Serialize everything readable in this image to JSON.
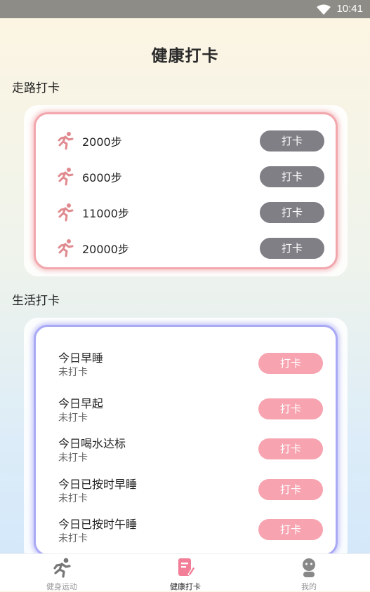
{
  "status_bar": {
    "time": "10:41"
  },
  "page": {
    "title": "健康打卡"
  },
  "walk": {
    "section_title": "走路打卡",
    "items": [
      {
        "steps": "2000步",
        "button": "打卡"
      },
      {
        "steps": "6000步",
        "button": "打卡"
      },
      {
        "steps": "11000步",
        "button": "打卡"
      },
      {
        "steps": "20000步",
        "button": "打卡"
      }
    ]
  },
  "life": {
    "section_title": "生活打卡",
    "items": [
      {
        "name": "今日早睡",
        "status": "未打卡",
        "button": "打卡"
      },
      {
        "name": "今日早起",
        "status": "未打卡",
        "button": "打卡"
      },
      {
        "name": "今日喝水达标",
        "status": "未打卡",
        "button": "打卡"
      },
      {
        "name": "今日已按时早睡",
        "status": "未打卡",
        "button": "打卡"
      },
      {
        "name": "今日已按时午睡",
        "status": "未打卡",
        "button": "打卡"
      }
    ]
  },
  "tabs": [
    {
      "label": "健身运动",
      "icon": "running-icon"
    },
    {
      "label": "健康打卡",
      "icon": "checkin-icon"
    },
    {
      "label": "我的",
      "icon": "profile-icon"
    }
  ],
  "colors": {
    "walk_accent": "#f2a7ad",
    "life_accent": "#a9a9f6",
    "gray_button": "#7f7f85",
    "pink_button": "#f7a3b0",
    "active_tab_icon": "#f27f97"
  }
}
